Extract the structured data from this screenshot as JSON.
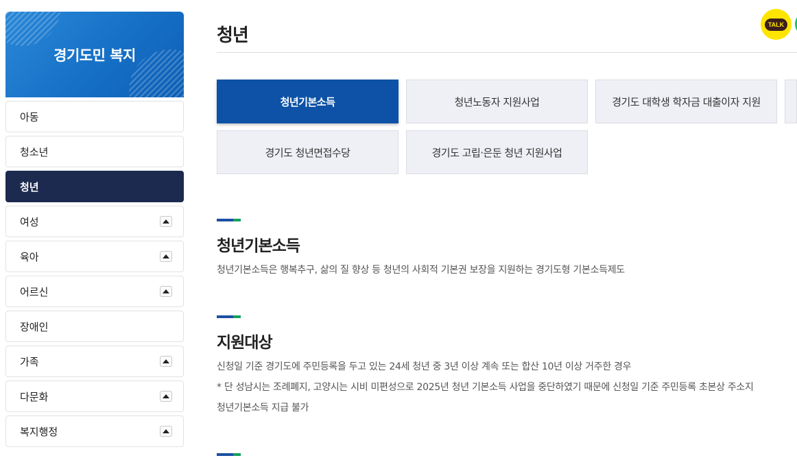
{
  "sidebar": {
    "banner_title": "경기도민 복지",
    "items": [
      {
        "label": "아동",
        "expandable": false,
        "active": false
      },
      {
        "label": "청소년",
        "expandable": false,
        "active": false
      },
      {
        "label": "청년",
        "expandable": false,
        "active": true
      },
      {
        "label": "여성",
        "expandable": true,
        "active": false
      },
      {
        "label": "육아",
        "expandable": true,
        "active": false
      },
      {
        "label": "어르신",
        "expandable": true,
        "active": false
      },
      {
        "label": "장애인",
        "expandable": false,
        "active": false
      },
      {
        "label": "가족",
        "expandable": true,
        "active": false
      },
      {
        "label": "다문화",
        "expandable": true,
        "active": false
      },
      {
        "label": "복지행정",
        "expandable": true,
        "active": false
      }
    ]
  },
  "header": {
    "title": "청년",
    "talk_label": "TALK",
    "talk_icon": "kakaotalk-icon",
    "share_icon": "share-icon"
  },
  "tabs": [
    {
      "label": "청년기본소득",
      "active": true
    },
    {
      "label": "청년노동자 지원사업",
      "active": false
    },
    {
      "label": "경기도 대학생 학자금 대출이자 지원",
      "active": false
    },
    {
      "label": "경기도 청년면접수당",
      "active": false
    },
    {
      "label": "경기도 고립·은둔 청년 지원사업",
      "active": false
    }
  ],
  "sections": {
    "intro": {
      "title": "청년기본소득",
      "text": "청년기본소득은 행복추구, 삶의 질 향상 등 청년의 사회적 기본권 보장을 지원하는 경기도형 기본소득제도"
    },
    "target": {
      "title": "지원대상",
      "line1": "신청일 기준 경기도에 주민등록을 두고 있는 24세 청년 중 3년 이상 계속 또는 합산 10년 이상 거주한 경우",
      "line2": "* 단 성남시는 조례폐지, 고양시는 시비 미편성으로 2025년 청년 기본소득 사업을 중단하였기 때문에 신청일 기준 주민등록 초본상 주소지",
      "line3": "청년기본소득 지급 불가"
    }
  },
  "colors": {
    "banner": "#1670c6",
    "active_menu": "#1c2a4f",
    "active_tab": "#0d52a6",
    "tab_bg": "#eff0f6",
    "marker_blue": "#1c4fa3",
    "marker_green": "#14a35b",
    "kakao_yellow": "#fee500"
  }
}
